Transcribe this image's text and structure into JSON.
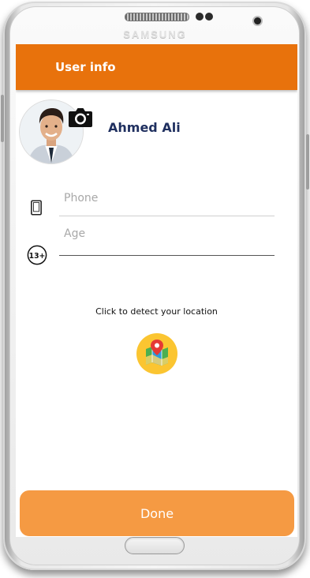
{
  "device": {
    "brand": "SAMSUNG"
  },
  "appbar": {
    "title": "User info"
  },
  "profile": {
    "name": "Ahmed Ali",
    "avatar_icon": "user-avatar-photo",
    "camera_icon": "camera-icon"
  },
  "form": {
    "phone": {
      "placeholder": "Phone",
      "value": "",
      "icon": "phone-icon"
    },
    "age": {
      "placeholder": "Age",
      "value": "",
      "icon": "age-13plus-icon",
      "badge": "13+"
    }
  },
  "location": {
    "prompt": "Click to detect your location",
    "icon": "map-pin-icon"
  },
  "actions": {
    "done_label": "Done"
  },
  "colors": {
    "appbar": "#e8720c",
    "done_button": "#f59a43",
    "name_text": "#1f2f5f",
    "map_badge": "#fbc531"
  }
}
